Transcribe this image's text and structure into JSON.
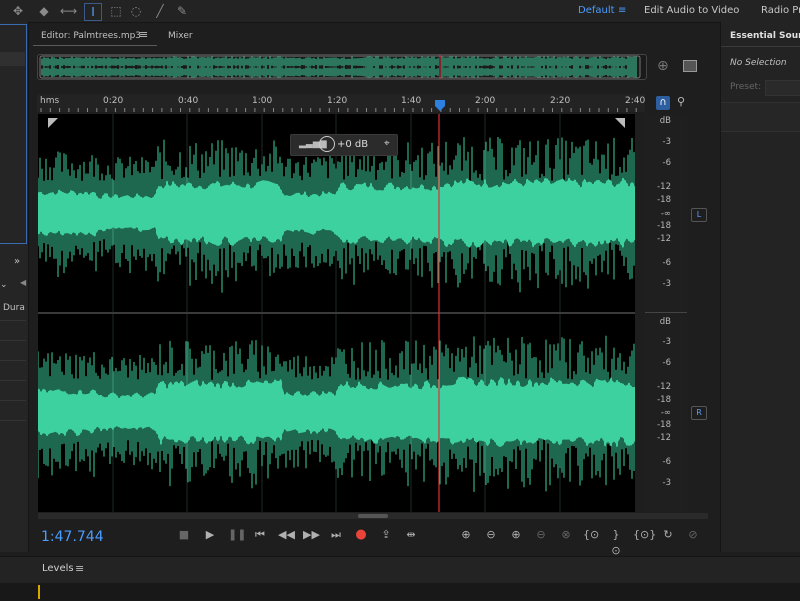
{
  "workspaces": {
    "default": "Default",
    "edit_audio_to_video": "Edit Audio to Video",
    "radio_production": "Radio Pro"
  },
  "editor": {
    "tab_label": "Editor: Palmtrees.mp3",
    "mixer_label": "Mixer"
  },
  "ruler": {
    "unit": "hms",
    "ticks": [
      "0:20",
      "0:40",
      "1:00",
      "1:20",
      "1:40",
      "2:00",
      "2:20",
      "2:40"
    ]
  },
  "hud": {
    "volume": "+0 dB"
  },
  "db_scale": {
    "top": [
      "dB",
      "-3",
      "-6",
      "-12",
      "-18",
      "-∞",
      "-18",
      "-12",
      "-6",
      "-3"
    ],
    "bottom": [
      "dB",
      "-3",
      "-6",
      "-12",
      "-18",
      "-∞",
      "-18",
      "-12",
      "-6",
      "-3"
    ],
    "left_channel": "L",
    "right_channel": "R"
  },
  "transport": {
    "timecode": "1:47.744"
  },
  "left_panel": {
    "duration_label": "Dura"
  },
  "right_panel": {
    "title": "Essential Sound",
    "selection": "No Selection",
    "preset_label": "Preset:"
  },
  "levels": {
    "title": "Levels"
  },
  "colors": {
    "waveform": "#3ed1a0",
    "playhead": "#e0303a",
    "accent": "#4a9cff"
  },
  "icons": [
    "move-tool-icon",
    "razor-tool-icon",
    "slip-tool-icon",
    "time-selection-tool-icon",
    "marquee-tool-icon",
    "lasso-tool-icon",
    "brush-tool-icon",
    "spot-healing-tool-icon"
  ]
}
